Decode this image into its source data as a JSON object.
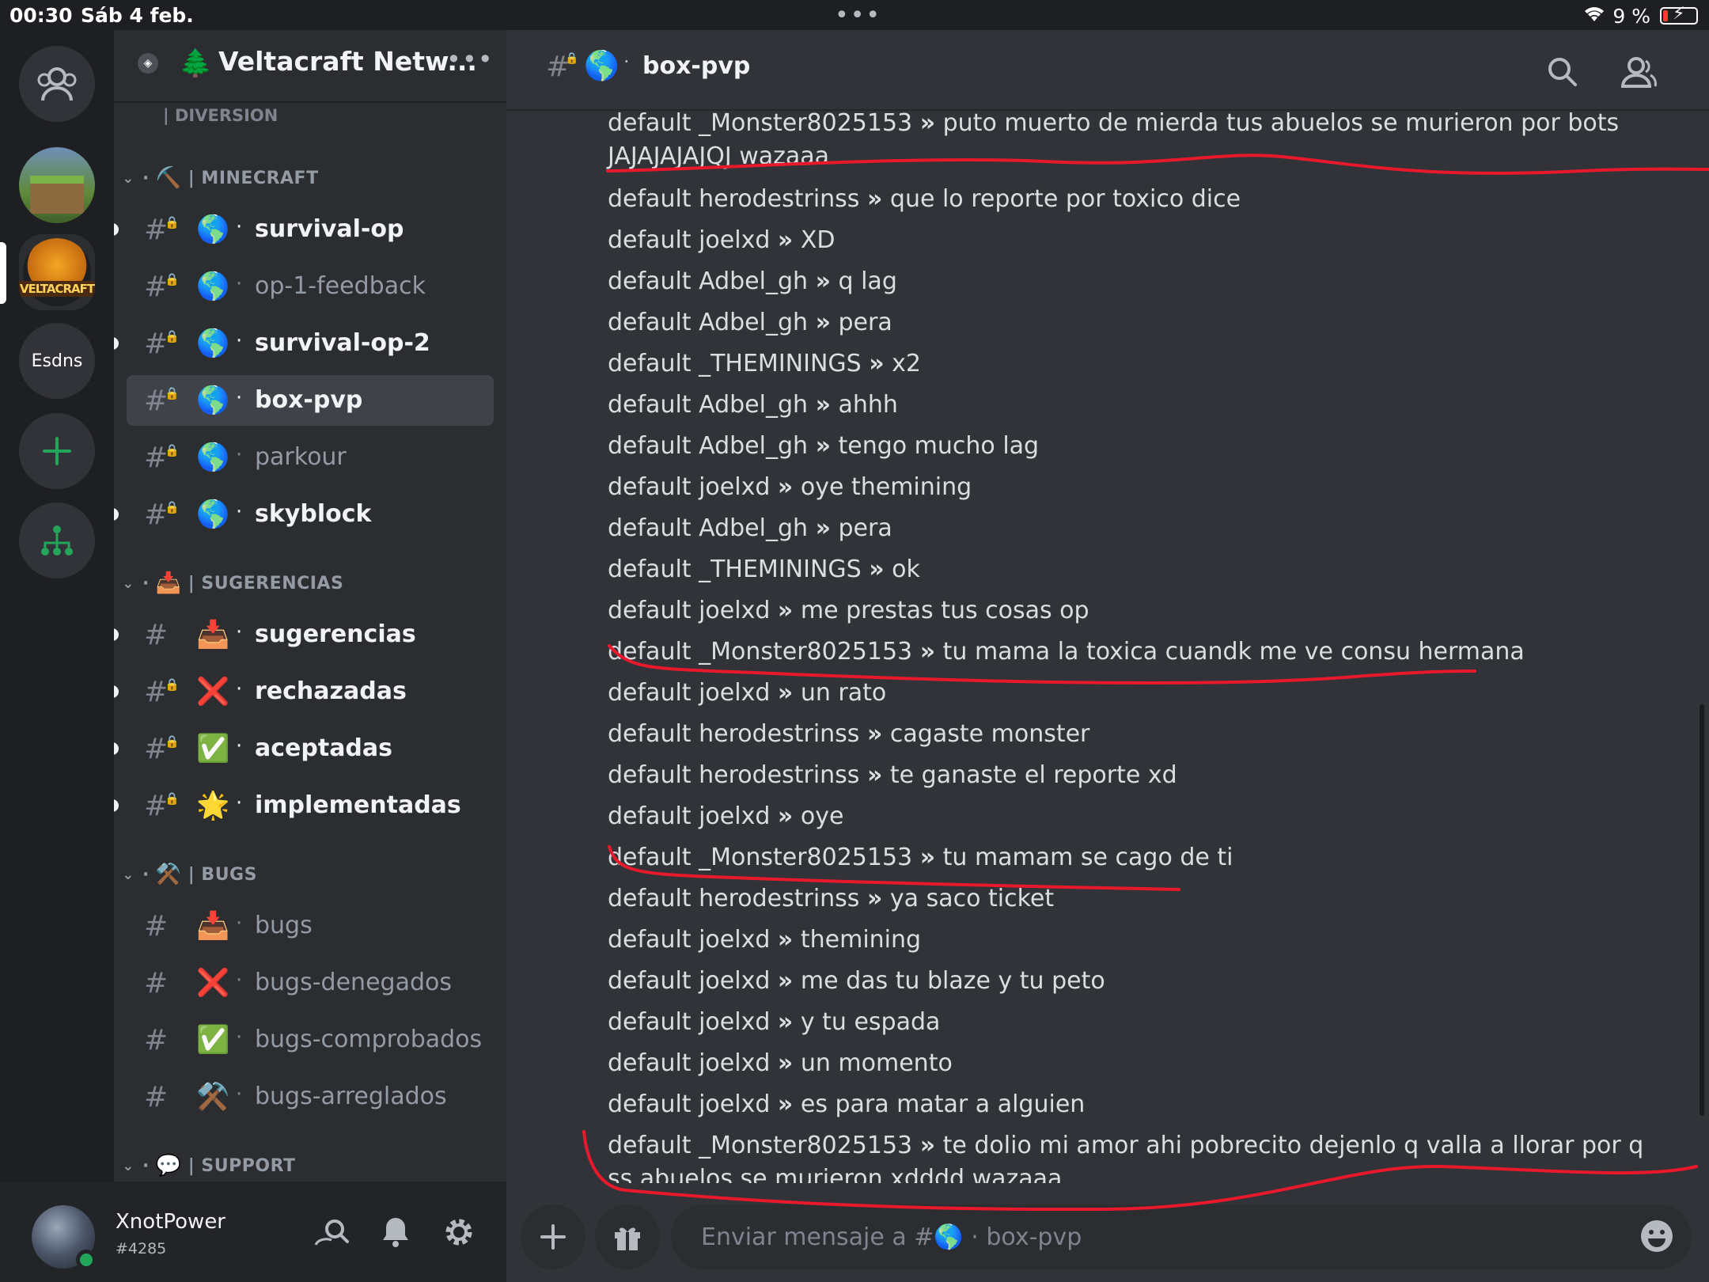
{
  "status_bar": {
    "time": "00:30",
    "date": "Sáb 4 feb.",
    "battery": "9 %"
  },
  "server_rail": {
    "esdns_label": "Esdns",
    "add_label": "+"
  },
  "guild": {
    "name": "Veltacraft Netw...",
    "logo_text": "VELTACRAFT"
  },
  "categories": {
    "diversion": "| DIVERSION",
    "minecraft": "| MINECRAFT",
    "sugerencias": "| SUGERENCIAS",
    "bugs": "| BUGS",
    "support": "| SUPPORT"
  },
  "channels": [
    {
      "name": "survival-op",
      "emoji": "🌎",
      "unread": true
    },
    {
      "name": "op-1-feedback",
      "emoji": "🌎",
      "unread": false
    },
    {
      "name": "survival-op-2",
      "emoji": "🌎",
      "unread": true
    },
    {
      "name": "box-pvp",
      "emoji": "🌎",
      "active": true
    },
    {
      "name": "parkour",
      "emoji": "🌎",
      "unread": false
    },
    {
      "name": "skyblock",
      "emoji": "🌎",
      "unread": true
    },
    {
      "name": "sugerencias",
      "emoji": "📥",
      "unread": true
    },
    {
      "name": "rechazadas",
      "emoji": "❌",
      "unread": true
    },
    {
      "name": "aceptadas",
      "emoji": "✅",
      "unread": true
    },
    {
      "name": "implementadas",
      "emoji": "🌟",
      "unread": true
    },
    {
      "name": "bugs",
      "emoji": "📥",
      "unread": false
    },
    {
      "name": "bugs-denegados",
      "emoji": "❌",
      "unread": false
    },
    {
      "name": "bugs-comprobados",
      "emoji": "✅",
      "unread": false
    },
    {
      "name": "bugs-arreglados",
      "emoji": "⚒️",
      "unread": false
    }
  ],
  "user": {
    "name": "XnotPower",
    "tag": "#4285"
  },
  "header": {
    "channel": "box-pvp",
    "emoji": "🌎"
  },
  "messages": [
    {
      "prefix": "default _Monster8025153",
      "text": "puto muerto de mierda tus abuelos se murieron por bots JAJAJAJAJQJ wazaaa"
    },
    {
      "prefix": "default herodestrinss",
      "text": "que lo reporte por toxico dice"
    },
    {
      "prefix": "default joelxd",
      "text": "XD"
    },
    {
      "prefix": "default Adbel_gh",
      "text": "q lag"
    },
    {
      "prefix": "default Adbel_gh",
      "text": "pera"
    },
    {
      "prefix": "default _THEMININGS",
      "text": "x2"
    },
    {
      "prefix": "default Adbel_gh",
      "text": "ahhh"
    },
    {
      "prefix": "default Adbel_gh",
      "text": "tengo mucho lag"
    },
    {
      "prefix": "default joelxd",
      "text": "oye themining"
    },
    {
      "prefix": "default Adbel_gh",
      "text": "pera"
    },
    {
      "prefix": "default _THEMININGS",
      "text": "ok"
    },
    {
      "prefix": "default joelxd",
      "text": "me prestas tus cosas op"
    },
    {
      "prefix": "default _Monster8025153",
      "text": "tu mama la toxica cuandk me ve consu hermana"
    },
    {
      "prefix": "default joelxd",
      "text": "un rato"
    },
    {
      "prefix": "default herodestrinss",
      "text": "cagaste monster"
    },
    {
      "prefix": "default herodestrinss",
      "text": "te ganaste el reporte xd"
    },
    {
      "prefix": "default joelxd",
      "text": "oye"
    },
    {
      "prefix": "default _Monster8025153",
      "text": "tu mamam se cago de ti"
    },
    {
      "prefix": "default herodestrinss",
      "text": "ya saco ticket"
    },
    {
      "prefix": "default joelxd",
      "text": "themining"
    },
    {
      "prefix": "default joelxd",
      "text": "me das tu blaze y tu peto"
    },
    {
      "prefix": "default joelxd",
      "text": "y tu espada"
    },
    {
      "prefix": "default joelxd",
      "text": "un momento"
    },
    {
      "prefix": "default joelxd",
      "text": "es para matar a alguien"
    },
    {
      "prefix": "default _Monster8025153",
      "text": "te dolio mi amor ahi pobrecito dejenlo q valla a llorar por q ss abuelos se murieron xdddd wazaaa"
    }
  ],
  "separator": "»",
  "composer": {
    "placeholder": "Enviar mensaje a #🌎 · box-pvp"
  },
  "colors": {
    "annotation": "#e8192c",
    "accent_green": "#23a55a"
  }
}
